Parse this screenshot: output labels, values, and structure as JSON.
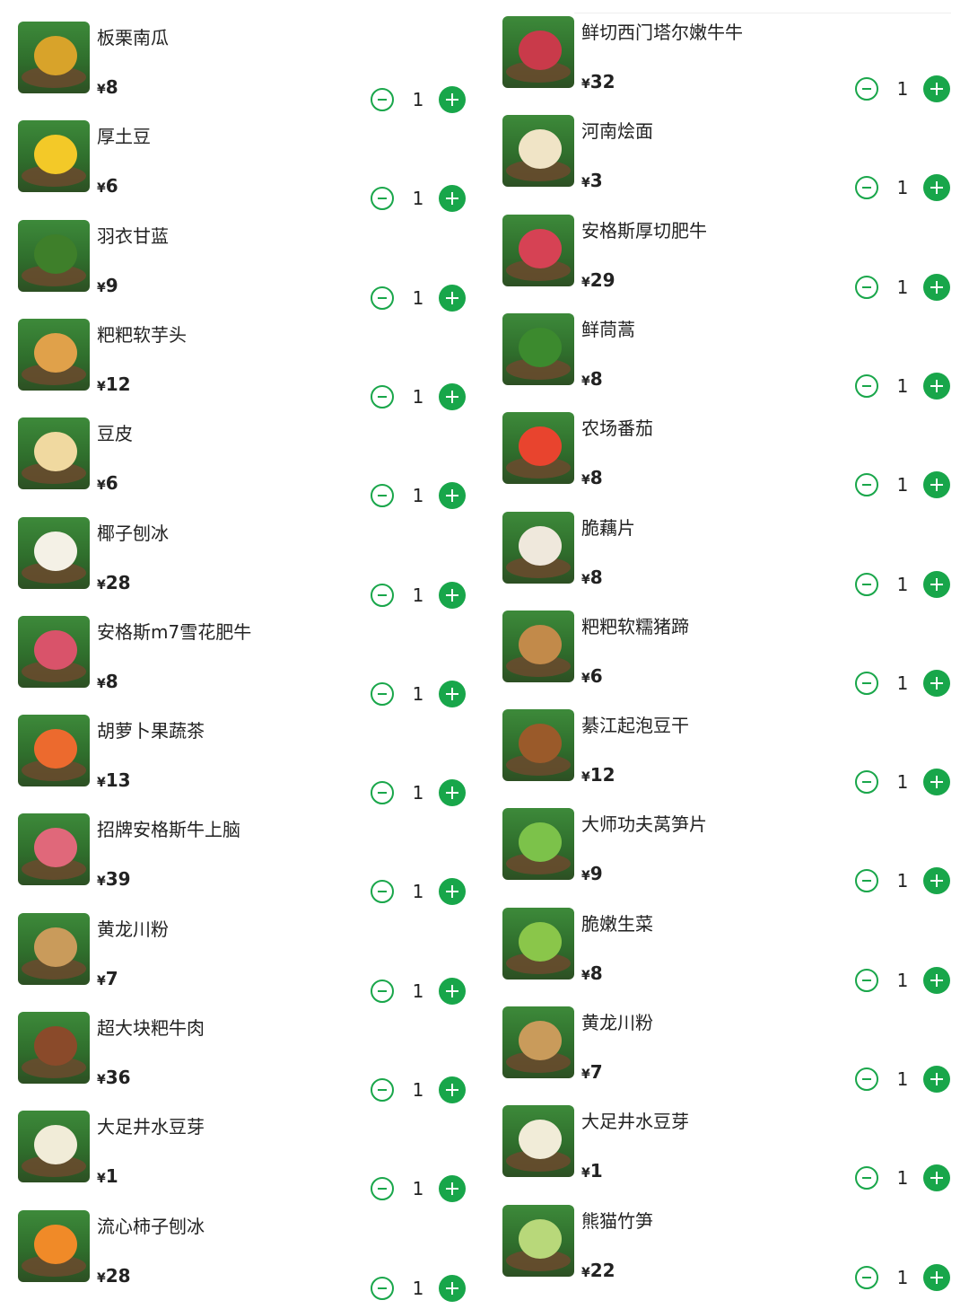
{
  "currency_symbol": "¥",
  "accent_color": "#18a64a",
  "left_items": [
    {
      "name": "板栗南瓜",
      "price": "8",
      "qty": "1",
      "food_color": "#d8a32a"
    },
    {
      "name": "厚土豆",
      "price": "6",
      "qty": "1",
      "food_color": "#f3c928"
    },
    {
      "name": "羽衣甘蓝",
      "price": "9",
      "qty": "1",
      "food_color": "#3e7f2a"
    },
    {
      "name": "粑粑软芋头",
      "price": "12",
      "qty": "1",
      "food_color": "#e0a14a"
    },
    {
      "name": "豆皮",
      "price": "6",
      "qty": "1",
      "food_color": "#f0d9a0"
    },
    {
      "name": "椰子刨冰",
      "price": "28",
      "qty": "1",
      "food_color": "#f4f1e6"
    },
    {
      "name": "安格斯m7雪花肥牛",
      "price": "8",
      "qty": "1",
      "food_color": "#d9536a"
    },
    {
      "name": "胡萝卜果蔬茶",
      "price": "13",
      "qty": "1",
      "food_color": "#ec6a2e"
    },
    {
      "name": "招牌安格斯牛上脑",
      "price": "39",
      "qty": "1",
      "food_color": "#e0687a"
    },
    {
      "name": "黄龙川粉",
      "price": "7",
      "qty": "1",
      "food_color": "#c99b5b"
    },
    {
      "name": "超大块粑牛肉",
      "price": "36",
      "qty": "1",
      "food_color": "#8a4a2a"
    },
    {
      "name": "大足井水豆芽",
      "price": "1",
      "qty": "1",
      "food_color": "#f1ecd8"
    },
    {
      "name": "流心柿子刨冰",
      "price": "28",
      "qty": "1",
      "food_color": "#f08a28"
    }
  ],
  "right_items": [
    {
      "name": "鲜切西门塔尔嫩牛牛",
      "price": "32",
      "qty": "1",
      "food_color": "#c93a4a"
    },
    {
      "name": "河南烩面",
      "price": "3",
      "qty": "1",
      "food_color": "#f0e4c6"
    },
    {
      "name": "安格斯厚切肥牛",
      "price": "29",
      "qty": "1",
      "food_color": "#d64254"
    },
    {
      "name": "鲜茼蒿",
      "price": "8",
      "qty": "1",
      "food_color": "#3c8a2e"
    },
    {
      "name": "农场番茄",
      "price": "8",
      "qty": "1",
      "food_color": "#e8442e"
    },
    {
      "name": "脆藕片",
      "price": "8",
      "qty": "1",
      "food_color": "#efe8dc"
    },
    {
      "name": "粑粑软糯猪蹄",
      "price": "6",
      "qty": "1",
      "food_color": "#c28a4a"
    },
    {
      "name": "綦江起泡豆干",
      "price": "12",
      "qty": "1",
      "food_color": "#9a5a2a"
    },
    {
      "name": "大师功夫莴笋片",
      "price": "9",
      "qty": "1",
      "food_color": "#7cc24a"
    },
    {
      "name": "脆嫩生菜",
      "price": "8",
      "qty": "1",
      "food_color": "#8ac64a"
    },
    {
      "name": "黄龙川粉",
      "price": "7",
      "qty": "1",
      "food_color": "#c99b5b"
    },
    {
      "name": "大足井水豆芽",
      "price": "1",
      "qty": "1",
      "food_color": "#f1ecd8"
    },
    {
      "name": "熊猫竹笋",
      "price": "22",
      "qty": "1",
      "food_color": "#b8d87a"
    }
  ]
}
